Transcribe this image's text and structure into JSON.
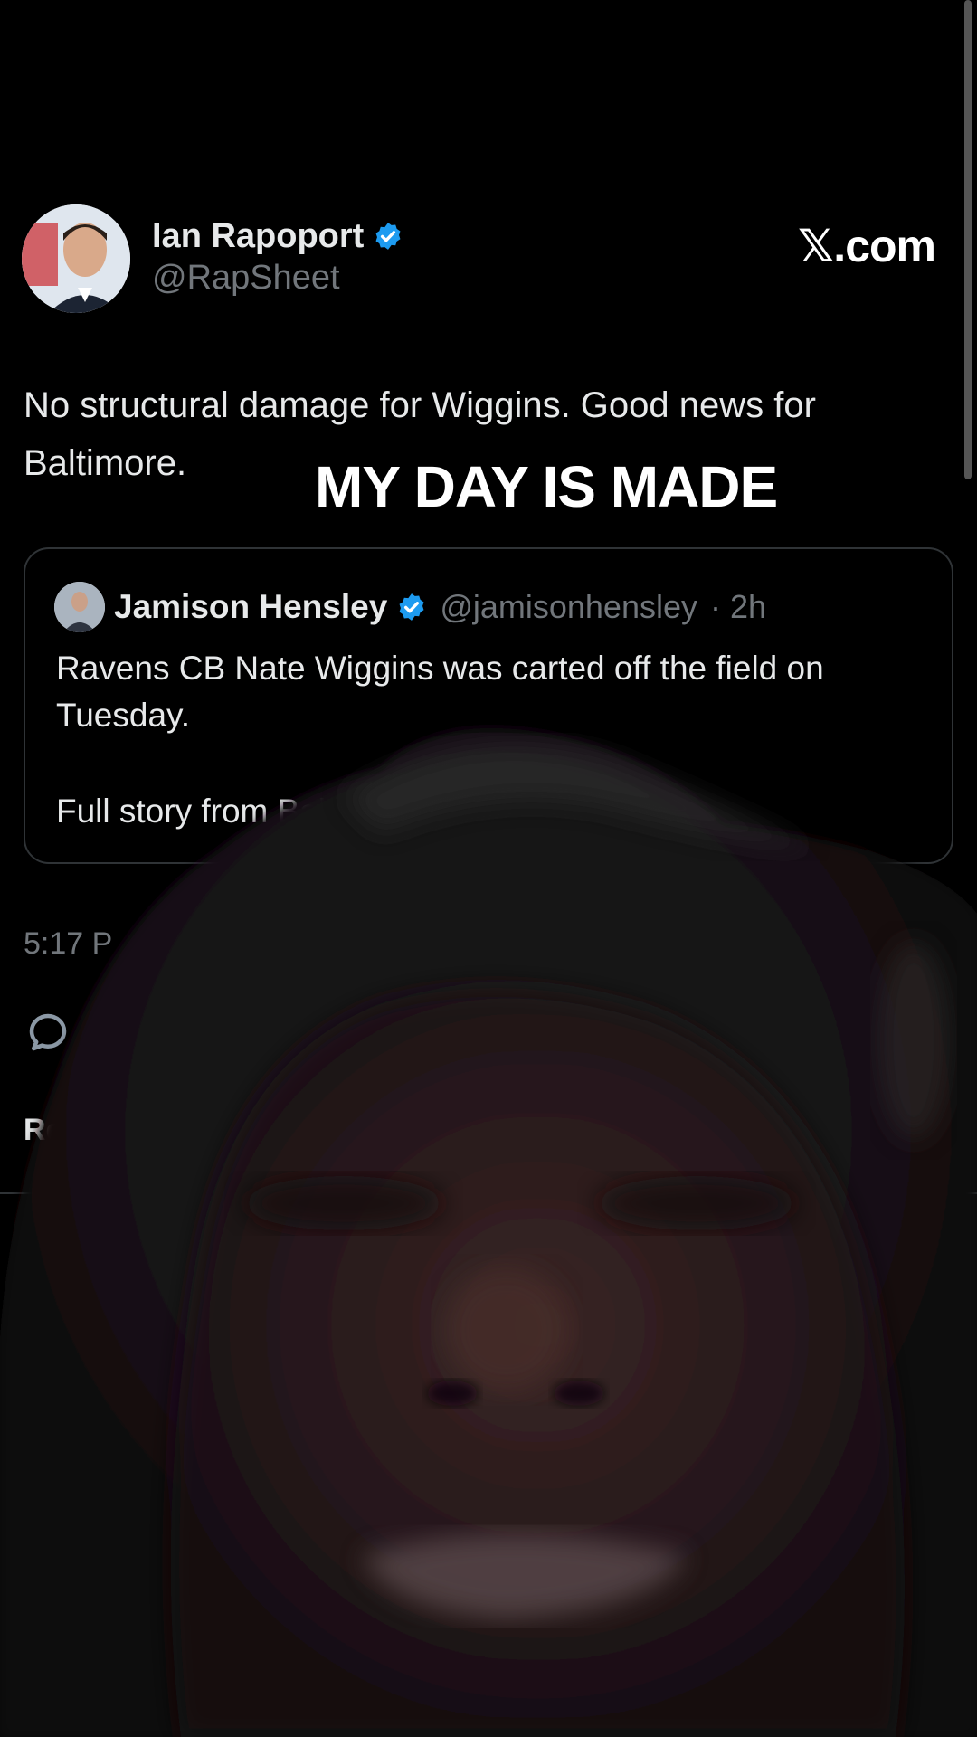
{
  "header": {
    "site_logo": "𝕏.com"
  },
  "tweet": {
    "author_name": "Ian Rapoport",
    "author_handle": "@RapSheet",
    "text": "No structural damage for Wiggins.  Good news for Baltimore.",
    "timestamp": "5:17 P",
    "relevant_label": "Re"
  },
  "quote": {
    "author_name": "Jamison Hensley",
    "author_handle": "@jamisonhensley",
    "time": "· 2h",
    "line1": "Ravens CB Nate Wiggins was carted off the field on Tuesday.",
    "line2": "Full story from Bal"
  },
  "overlay": {
    "caption": "MY DAY IS MADE"
  },
  "colors": {
    "background": "#000000",
    "text_primary": "#e7e9ea",
    "text_secondary": "#71767b",
    "verified_blue": "#1d9bf0",
    "border": "#2f3336"
  }
}
